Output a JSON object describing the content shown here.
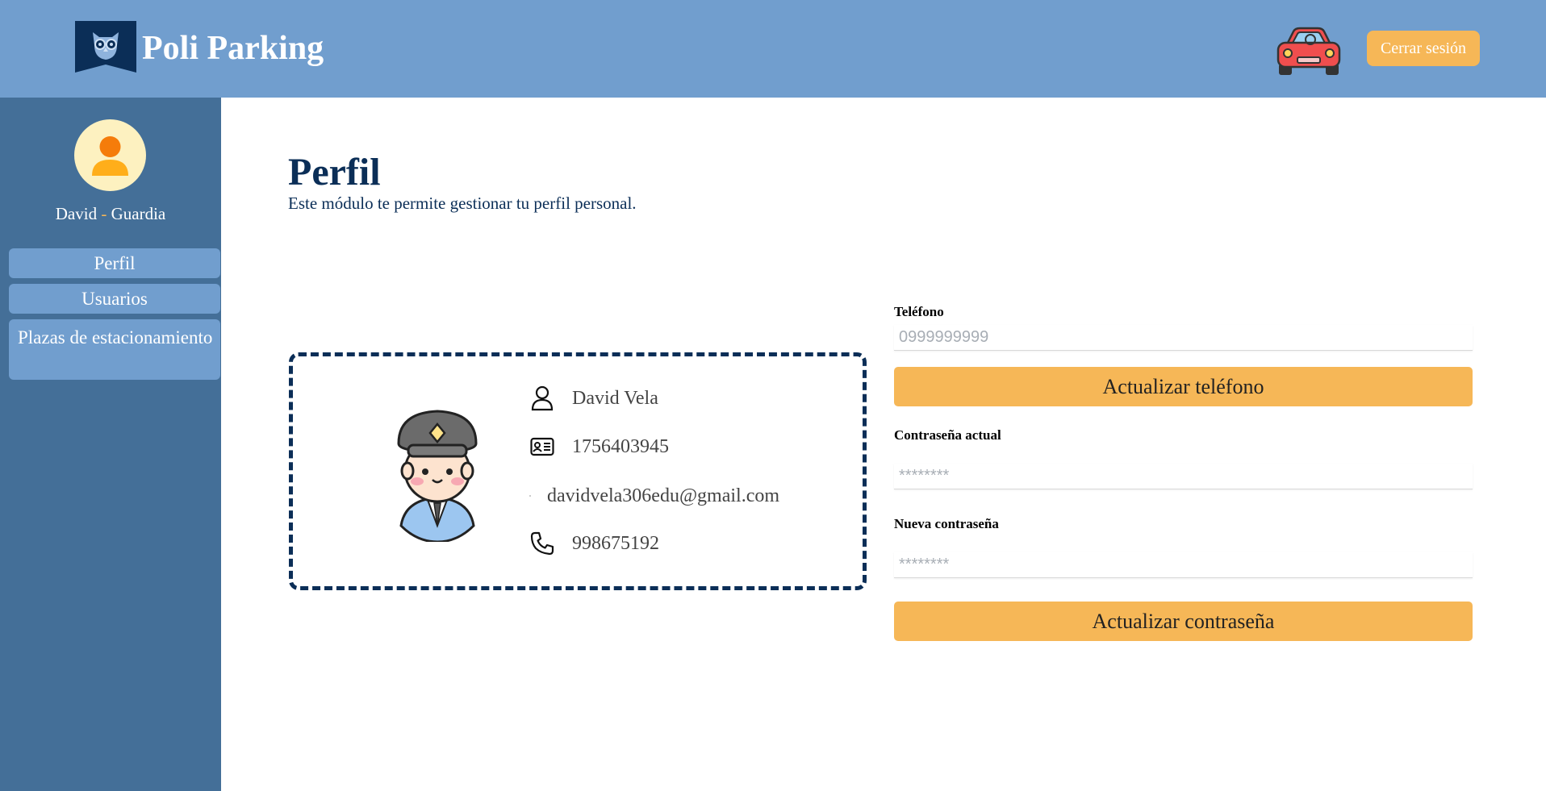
{
  "app": {
    "brand": "Poli Parking"
  },
  "header": {
    "logout_label": "Cerrar sesión",
    "accent": "#f6b757",
    "bg": "#719ece"
  },
  "sidebar": {
    "user_name": "David",
    "separator": " - ",
    "user_role": "Guardia",
    "items": [
      {
        "label": "Perfil"
      },
      {
        "label": "Usuarios"
      },
      {
        "label": "Plazas de estacionamiento"
      }
    ]
  },
  "page": {
    "title": "Perfil",
    "description": "Este módulo te permite gestionar tu perfil personal."
  },
  "profile": {
    "name": "David Vela",
    "id_number": "1756403945",
    "email": "davidvela306edu@gmail.com",
    "phone": "998675192",
    "icons": [
      "user-icon",
      "id-card-icon",
      "email-icon",
      "phone-icon"
    ]
  },
  "form": {
    "phone_label": "Teléfono",
    "phone_placeholder": "0999999999",
    "phone_button": "Actualizar teléfono",
    "current_password_label": "Contraseña actual",
    "current_password_placeholder": "********",
    "new_password_label": "Nueva contraseña",
    "new_password_placeholder": "********",
    "password_button": "Actualizar contraseña"
  }
}
